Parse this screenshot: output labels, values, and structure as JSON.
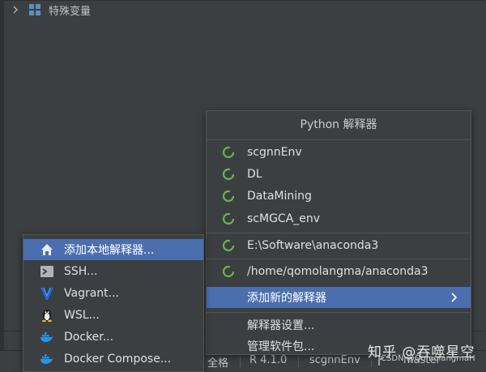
{
  "tree": {
    "node_label": "特殊变量"
  },
  "popup": {
    "title": "Python 解释器",
    "envs": [
      "scgnnEnv",
      "DL",
      "DataMining",
      "scMGCA_env"
    ],
    "paths": [
      "E:\\Software\\anaconda3",
      "/home/qomolangma/anaconda3"
    ],
    "add_new": "添加新的解释器",
    "settings": "解释器设置...",
    "manage_packages": "管理软件包..."
  },
  "submenu": {
    "items": [
      "添加本地解释器...",
      "SSH...",
      "Vagrant...",
      "WSL...",
      "Docker...",
      "Docker Compose..."
    ]
  },
  "statusbar": {
    "encoding": "全格",
    "r_version": "R 4.1.0",
    "interpreter": "scgnnEnv",
    "branch": "master"
  },
  "watermark": {
    "text": "知乎 @吞噬星空",
    "sub": "CSDN @QomolangmaH"
  },
  "colors": {
    "selection": "#4b6eaf",
    "spinner": "#6bb34a",
    "background": "#3b3f41"
  }
}
